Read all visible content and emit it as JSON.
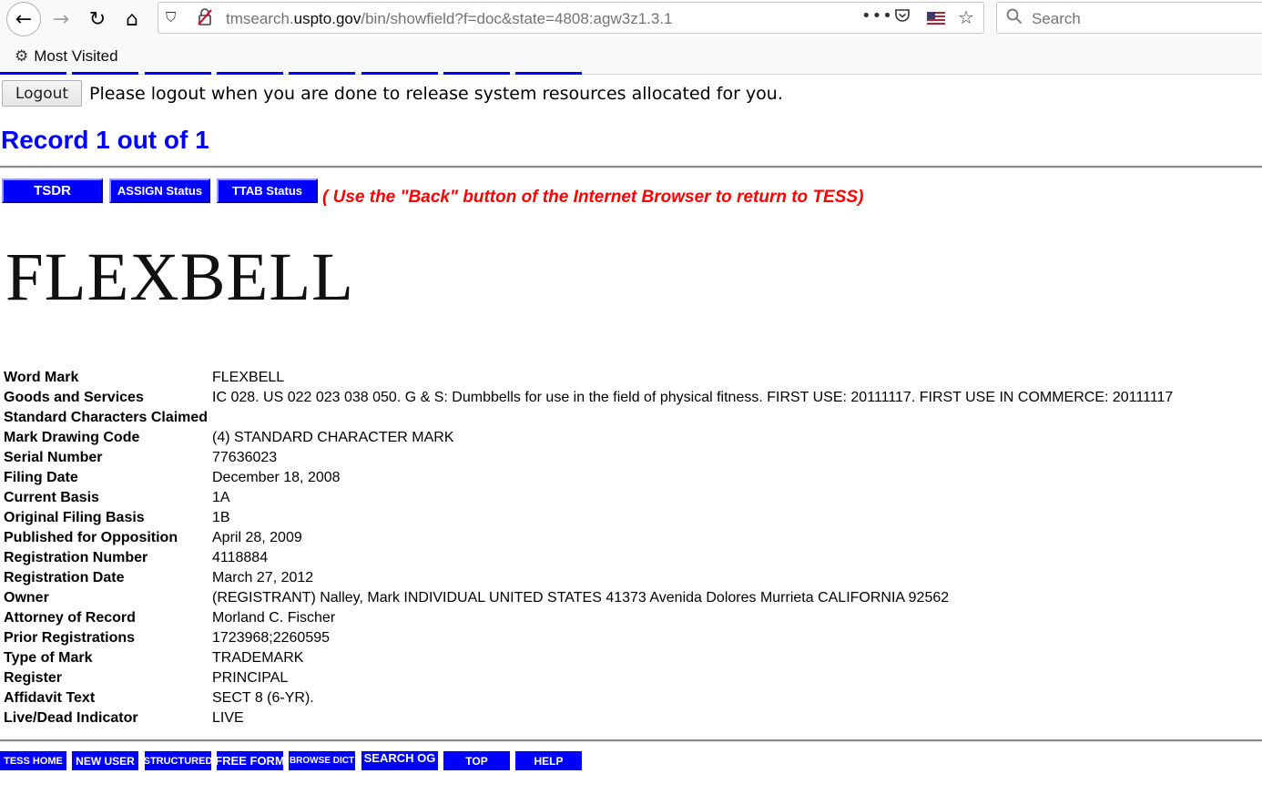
{
  "browser": {
    "url_host_prefix": "tmsearch.",
    "url_host": "uspto.gov",
    "url_path": "/bin/showfield?f=doc&state=4808:agw3z1.3.1",
    "search_placeholder": "Search",
    "bookmark_folder": "Most Visited",
    "icons": {
      "back": "←",
      "forward": "→",
      "reload": "↻",
      "home": "⌂",
      "shield": "⛉",
      "insecure": "⚠",
      "more": "•••",
      "pocket": "⛉",
      "star": "☆",
      "search": "⚲",
      "gear": "⚙"
    }
  },
  "session": {
    "logout_label": "Logout",
    "logout_message": "Please logout when you are done to release system resources allocated for you."
  },
  "record_title": "Record 1 out of 1",
  "status_buttons": {
    "tsdr": "TSDR",
    "assign": "ASSIGN Status",
    "ttab": "TTAB Status"
  },
  "back_note": "( Use the \"Back\" button of the Internet Browser to return to TESS)",
  "mark_image_text": "FLEXBELL",
  "fields": [
    {
      "key": "Word Mark",
      "value": "FLEXBELL"
    },
    {
      "key": "Goods and Services",
      "value": "IC 028. US 022 023 038 050. G & S: Dumbbells for use in the field of physical fitness. FIRST USE: 20111117. FIRST USE IN COMMERCE: 20111117"
    },
    {
      "key": "Standard Characters Claimed",
      "value": ""
    },
    {
      "key": "Mark Drawing Code",
      "value": "(4) STANDARD CHARACTER MARK"
    },
    {
      "key": "Serial Number",
      "value": "77636023"
    },
    {
      "key": "Filing Date",
      "value": "December 18, 2008"
    },
    {
      "key": "Current Basis",
      "value": "1A"
    },
    {
      "key": "Original Filing Basis",
      "value": "1B"
    },
    {
      "key": "Published for Opposition",
      "value": "April 28, 2009"
    },
    {
      "key": "Registration Number",
      "value": "4118884"
    },
    {
      "key": "Registration Date",
      "value": "March 27, 2012"
    },
    {
      "key": "Owner",
      "value": "(REGISTRANT) Nalley, Mark INDIVIDUAL UNITED STATES 41373 Avenida Dolores Murrieta CALIFORNIA 92562"
    },
    {
      "key": "Attorney of Record",
      "value": "Morland C. Fischer"
    },
    {
      "key": "Prior Registrations",
      "value": "1723968;2260595"
    },
    {
      "key": "Type of Mark",
      "value": "TRADEMARK"
    },
    {
      "key": "Register",
      "value": "PRINCIPAL"
    },
    {
      "key": "Affidavit Text",
      "value": "SECT 8 (6-YR)."
    },
    {
      "key": "Live/Dead Indicator",
      "value": "LIVE"
    }
  ],
  "bottom_nav": {
    "tess_home": "TESS HOME",
    "new_user": "NEW USER",
    "structured": "STRUCTURED",
    "free_form": "FREE FORM",
    "browse_dict": "BROWSE DICT",
    "search_og": "SEARCH OG",
    "top": "TOP",
    "help": "HELP"
  },
  "colors": {
    "link_blue": "#0000ff",
    "warning_red": "#ff0000"
  }
}
